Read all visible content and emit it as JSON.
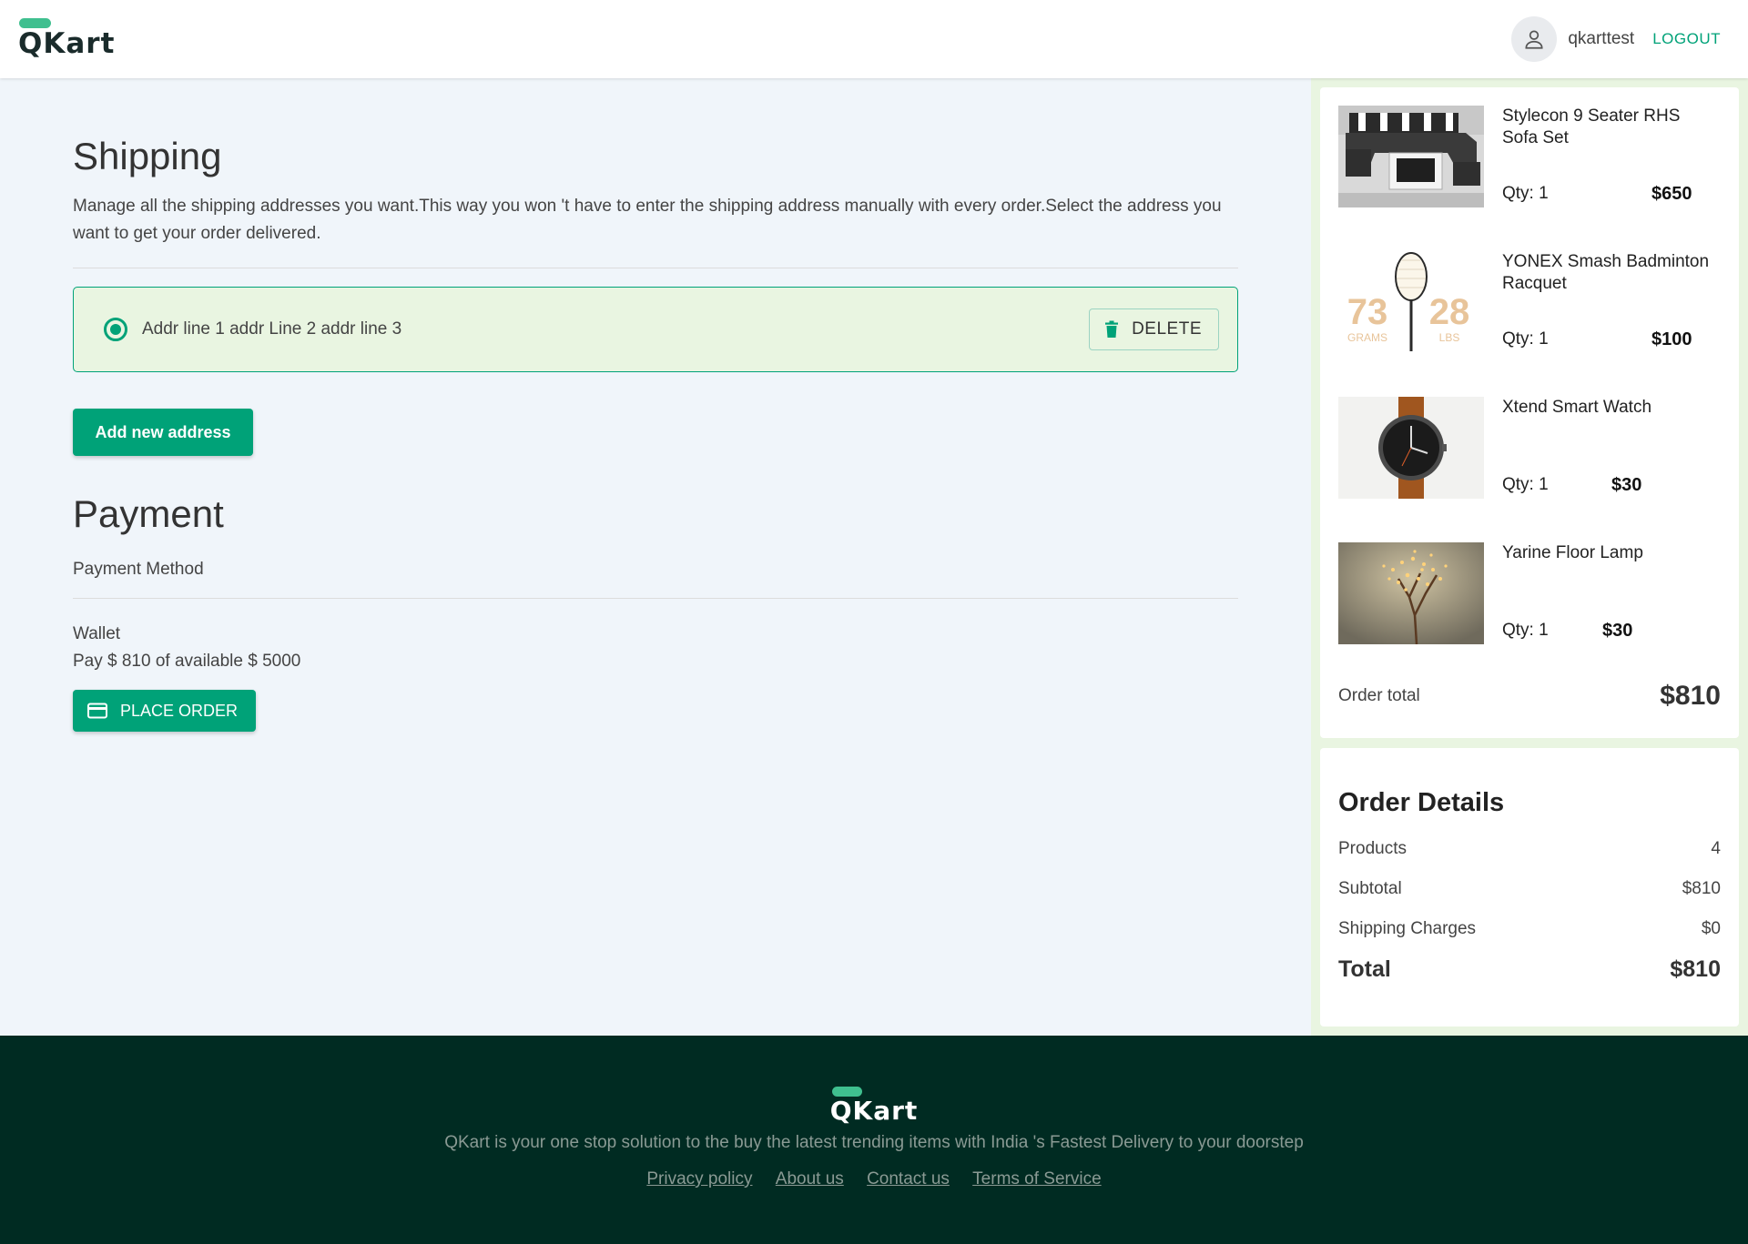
{
  "header": {
    "logo_text": "QKart",
    "username": "qkarttest",
    "logout_label": "LOGOUT"
  },
  "shipping": {
    "title": "Shipping",
    "description": "Manage all the shipping addresses you want.This way you won 't have to enter the shipping address manually with every order.Select the address you want to get your order delivered.",
    "addresses": [
      {
        "text": "Addr line 1 addr Line 2 addr line 3",
        "selected": true
      }
    ],
    "delete_label": "DELETE",
    "add_label": "Add new address"
  },
  "payment": {
    "title": "Payment",
    "method_label": "Payment Method",
    "wallet_label": "Wallet",
    "wallet_text": "Pay $ 810 of available $ 5000",
    "place_order_label": "PLACE ORDER"
  },
  "cart": {
    "items": [
      {
        "name": "Stylecon 9 Seater RHS Sofa Set",
        "qty": "Qty: 1",
        "price": "$650",
        "image": "sofa"
      },
      {
        "name": "YONEX Smash Badminton Racquet",
        "qty": "Qty: 1",
        "price": "$100",
        "image": "racquet",
        "image_text": [
          "73",
          "GRAMS",
          "28",
          "LBS"
        ]
      },
      {
        "name": "Xtend Smart Watch",
        "qty": "Qty: 1",
        "price": "$30",
        "image": "watch"
      },
      {
        "name": "Yarine Floor Lamp",
        "qty": "Qty: 1",
        "price": "$30",
        "image": "lamp"
      }
    ],
    "total_label": "Order total",
    "total_value": "$810"
  },
  "order_details": {
    "title": "Order Details",
    "rows": [
      {
        "label": "Products",
        "value": "4"
      },
      {
        "label": "Subtotal",
        "value": "$810"
      },
      {
        "label": "Shipping Charges",
        "value": "$0"
      }
    ],
    "total_label": "Total",
    "total_value": "$810"
  },
  "footer": {
    "logo_text": "QKart",
    "tagline": "QKart is your one stop solution to the buy the latest trending items with India 's Fastest Delivery to your doorstep",
    "links": [
      "Privacy policy",
      "About us",
      "Contact us",
      "Terms of Service"
    ]
  },
  "colors": {
    "accent": "#00a278",
    "accent_light": "#e9f5e1",
    "footer_bg": "#002b22",
    "page_bg": "#f0f5fa"
  }
}
